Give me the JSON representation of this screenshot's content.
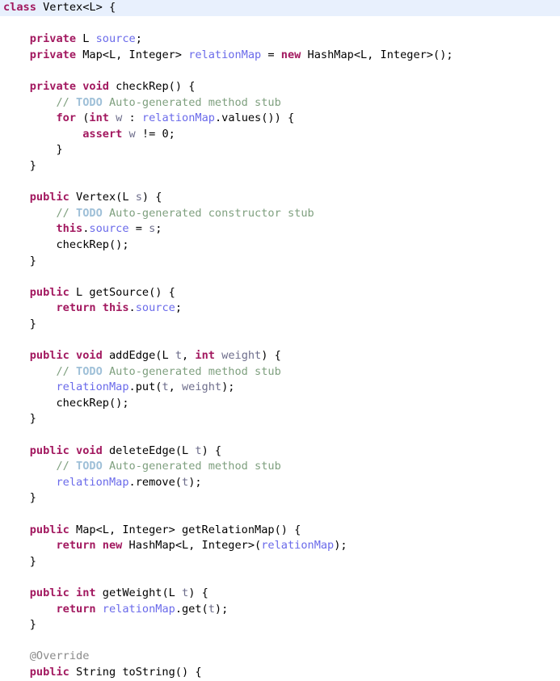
{
  "editor": {
    "language": "java",
    "class_name": "Vertex",
    "background_color": "#ffffff",
    "highlight_color": "#e8f0fd",
    "colors": {
      "keyword": "#a2185f",
      "field": "#6a6aea",
      "parameter": "#6e6e8c",
      "comment": "#7fa07f",
      "todo_tag": "#9fc0d8",
      "annotation": "#8a8a8a",
      "plain": "#000000"
    },
    "highlighted_line_index": 0,
    "lines": [
      {
        "indent": 0,
        "highlight": true,
        "tokens": [
          {
            "t": "kw",
            "v": "class"
          },
          {
            "t": "plain",
            "v": " Vertex<L> {"
          }
        ]
      },
      {
        "indent": 0,
        "tokens": []
      },
      {
        "indent": 1,
        "tokens": [
          {
            "t": "kw",
            "v": "private"
          },
          {
            "t": "plain",
            "v": " L "
          },
          {
            "t": "field",
            "v": "source"
          },
          {
            "t": "plain",
            "v": ";"
          }
        ]
      },
      {
        "indent": 1,
        "tokens": [
          {
            "t": "kw",
            "v": "private"
          },
          {
            "t": "plain",
            "v": " Map<L, Integer> "
          },
          {
            "t": "field",
            "v": "relationMap"
          },
          {
            "t": "plain",
            "v": " = "
          },
          {
            "t": "kw",
            "v": "new"
          },
          {
            "t": "plain",
            "v": " HashMap<L, Integer>();"
          }
        ]
      },
      {
        "indent": 0,
        "tokens": []
      },
      {
        "indent": 1,
        "tokens": [
          {
            "t": "kw",
            "v": "private"
          },
          {
            "t": "plain",
            "v": " "
          },
          {
            "t": "kw",
            "v": "void"
          },
          {
            "t": "plain",
            "v": " checkRep() {"
          }
        ]
      },
      {
        "indent": 2,
        "tokens": [
          {
            "t": "cmt",
            "v": "// "
          },
          {
            "t": "todo",
            "v": "TODO"
          },
          {
            "t": "cmt",
            "v": " Auto-generated method stub"
          }
        ]
      },
      {
        "indent": 2,
        "tokens": [
          {
            "t": "kw",
            "v": "for"
          },
          {
            "t": "plain",
            "v": " ("
          },
          {
            "t": "kw",
            "v": "int"
          },
          {
            "t": "plain",
            "v": " "
          },
          {
            "t": "param",
            "v": "w"
          },
          {
            "t": "plain",
            "v": " : "
          },
          {
            "t": "field",
            "v": "relationMap"
          },
          {
            "t": "plain",
            "v": ".values()) {"
          }
        ]
      },
      {
        "indent": 3,
        "tokens": [
          {
            "t": "kw",
            "v": "assert"
          },
          {
            "t": "plain",
            "v": " "
          },
          {
            "t": "param",
            "v": "w"
          },
          {
            "t": "plain",
            "v": " != "
          },
          {
            "t": "num",
            "v": "0"
          },
          {
            "t": "plain",
            "v": ";"
          }
        ]
      },
      {
        "indent": 2,
        "tokens": [
          {
            "t": "plain",
            "v": "}"
          }
        ]
      },
      {
        "indent": 1,
        "tokens": [
          {
            "t": "plain",
            "v": "}"
          }
        ]
      },
      {
        "indent": 0,
        "tokens": []
      },
      {
        "indent": 1,
        "tokens": [
          {
            "t": "kw",
            "v": "public"
          },
          {
            "t": "plain",
            "v": " Vertex(L "
          },
          {
            "t": "param",
            "v": "s"
          },
          {
            "t": "plain",
            "v": ") {"
          }
        ]
      },
      {
        "indent": 2,
        "tokens": [
          {
            "t": "cmt",
            "v": "// "
          },
          {
            "t": "todo",
            "v": "TODO"
          },
          {
            "t": "cmt",
            "v": " Auto-generated constructor stub"
          }
        ]
      },
      {
        "indent": 2,
        "tokens": [
          {
            "t": "kw",
            "v": "this"
          },
          {
            "t": "plain",
            "v": "."
          },
          {
            "t": "field",
            "v": "source"
          },
          {
            "t": "plain",
            "v": " = "
          },
          {
            "t": "param",
            "v": "s"
          },
          {
            "t": "plain",
            "v": ";"
          }
        ]
      },
      {
        "indent": 2,
        "tokens": [
          {
            "t": "plain",
            "v": "checkRep();"
          }
        ]
      },
      {
        "indent": 1,
        "tokens": [
          {
            "t": "plain",
            "v": "}"
          }
        ]
      },
      {
        "indent": 0,
        "tokens": []
      },
      {
        "indent": 1,
        "tokens": [
          {
            "t": "kw",
            "v": "public"
          },
          {
            "t": "plain",
            "v": " L getSource() {"
          }
        ]
      },
      {
        "indent": 2,
        "tokens": [
          {
            "t": "kw",
            "v": "return"
          },
          {
            "t": "plain",
            "v": " "
          },
          {
            "t": "kw",
            "v": "this"
          },
          {
            "t": "plain",
            "v": "."
          },
          {
            "t": "field",
            "v": "source"
          },
          {
            "t": "plain",
            "v": ";"
          }
        ]
      },
      {
        "indent": 1,
        "tokens": [
          {
            "t": "plain",
            "v": "}"
          }
        ]
      },
      {
        "indent": 0,
        "tokens": []
      },
      {
        "indent": 1,
        "tokens": [
          {
            "t": "kw",
            "v": "public"
          },
          {
            "t": "plain",
            "v": " "
          },
          {
            "t": "kw",
            "v": "void"
          },
          {
            "t": "plain",
            "v": " addEdge(L "
          },
          {
            "t": "param",
            "v": "t"
          },
          {
            "t": "plain",
            "v": ", "
          },
          {
            "t": "kw",
            "v": "int"
          },
          {
            "t": "plain",
            "v": " "
          },
          {
            "t": "param",
            "v": "weight"
          },
          {
            "t": "plain",
            "v": ") {"
          }
        ]
      },
      {
        "indent": 2,
        "tokens": [
          {
            "t": "cmt",
            "v": "// "
          },
          {
            "t": "todo",
            "v": "TODO"
          },
          {
            "t": "cmt",
            "v": " Auto-generated method stub"
          }
        ]
      },
      {
        "indent": 2,
        "tokens": [
          {
            "t": "field",
            "v": "relationMap"
          },
          {
            "t": "plain",
            "v": ".put("
          },
          {
            "t": "param",
            "v": "t"
          },
          {
            "t": "plain",
            "v": ", "
          },
          {
            "t": "param",
            "v": "weight"
          },
          {
            "t": "plain",
            "v": ");"
          }
        ]
      },
      {
        "indent": 2,
        "tokens": [
          {
            "t": "plain",
            "v": "checkRep();"
          }
        ]
      },
      {
        "indent": 1,
        "tokens": [
          {
            "t": "plain",
            "v": "}"
          }
        ]
      },
      {
        "indent": 0,
        "tokens": []
      },
      {
        "indent": 1,
        "tokens": [
          {
            "t": "kw",
            "v": "public"
          },
          {
            "t": "plain",
            "v": " "
          },
          {
            "t": "kw",
            "v": "void"
          },
          {
            "t": "plain",
            "v": " deleteEdge(L "
          },
          {
            "t": "param",
            "v": "t"
          },
          {
            "t": "plain",
            "v": ") {"
          }
        ]
      },
      {
        "indent": 2,
        "tokens": [
          {
            "t": "cmt",
            "v": "// "
          },
          {
            "t": "todo",
            "v": "TODO"
          },
          {
            "t": "cmt",
            "v": " Auto-generated method stub"
          }
        ]
      },
      {
        "indent": 2,
        "tokens": [
          {
            "t": "field",
            "v": "relationMap"
          },
          {
            "t": "plain",
            "v": ".remove("
          },
          {
            "t": "param",
            "v": "t"
          },
          {
            "t": "plain",
            "v": ");"
          }
        ]
      },
      {
        "indent": 1,
        "tokens": [
          {
            "t": "plain",
            "v": "}"
          }
        ]
      },
      {
        "indent": 0,
        "tokens": []
      },
      {
        "indent": 1,
        "tokens": [
          {
            "t": "kw",
            "v": "public"
          },
          {
            "t": "plain",
            "v": " Map<L, Integer> getRelationMap() {"
          }
        ]
      },
      {
        "indent": 2,
        "tokens": [
          {
            "t": "kw",
            "v": "return"
          },
          {
            "t": "plain",
            "v": " "
          },
          {
            "t": "kw",
            "v": "new"
          },
          {
            "t": "plain",
            "v": " HashMap<L, Integer>("
          },
          {
            "t": "field",
            "v": "relationMap"
          },
          {
            "t": "plain",
            "v": ");"
          }
        ]
      },
      {
        "indent": 1,
        "tokens": [
          {
            "t": "plain",
            "v": "}"
          }
        ]
      },
      {
        "indent": 0,
        "tokens": []
      },
      {
        "indent": 1,
        "tokens": [
          {
            "t": "kw",
            "v": "public"
          },
          {
            "t": "plain",
            "v": " "
          },
          {
            "t": "kw",
            "v": "int"
          },
          {
            "t": "plain",
            "v": " getWeight(L "
          },
          {
            "t": "param",
            "v": "t"
          },
          {
            "t": "plain",
            "v": ") {"
          }
        ]
      },
      {
        "indent": 2,
        "tokens": [
          {
            "t": "kw",
            "v": "return"
          },
          {
            "t": "plain",
            "v": " "
          },
          {
            "t": "field",
            "v": "relationMap"
          },
          {
            "t": "plain",
            "v": ".get("
          },
          {
            "t": "param",
            "v": "t"
          },
          {
            "t": "plain",
            "v": ");"
          }
        ]
      },
      {
        "indent": 1,
        "tokens": [
          {
            "t": "plain",
            "v": "}"
          }
        ]
      },
      {
        "indent": 0,
        "tokens": []
      },
      {
        "indent": 1,
        "tokens": [
          {
            "t": "anno",
            "v": "@Override"
          }
        ]
      },
      {
        "indent": 1,
        "tokens": [
          {
            "t": "kw",
            "v": "public"
          },
          {
            "t": "plain",
            "v": " String toString() {"
          }
        ]
      }
    ]
  }
}
